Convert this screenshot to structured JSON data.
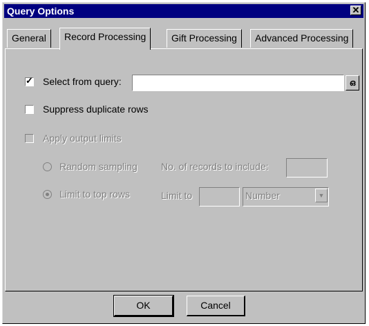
{
  "window": {
    "title": "Query Options",
    "close_glyph": "✕"
  },
  "tabs": [
    {
      "label": "General",
      "active": false
    },
    {
      "label": "Record Processing",
      "active": true
    },
    {
      "label": "Gift Processing",
      "active": false
    },
    {
      "label": "Advanced Processing",
      "active": false
    }
  ],
  "record_processing": {
    "select_from_query": {
      "label": "Select from query:",
      "checked": true,
      "value": "",
      "browse_icon": "binoculars-icon"
    },
    "suppress_duplicates": {
      "label": "Suppress duplicate rows",
      "checked": false
    },
    "apply_output_limits": {
      "label": "Apply output limits",
      "checked": false,
      "enabled": false
    },
    "random_sampling": {
      "label": "Random sampling",
      "selected": false,
      "records_label": "No. of records to include:",
      "records_value": ""
    },
    "limit_top_rows": {
      "label": "Limit to top rows",
      "selected": true,
      "limit_label": "Limit to",
      "limit_value": "",
      "unit_selected": "Number"
    }
  },
  "buttons": {
    "ok": "OK",
    "cancel": "Cancel"
  }
}
